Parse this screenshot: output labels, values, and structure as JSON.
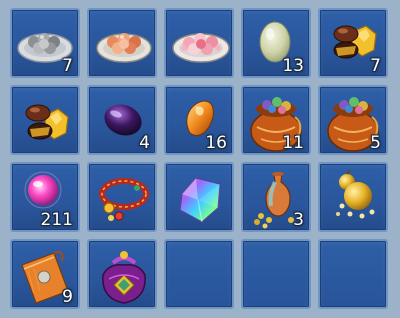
{
  "inventory": {
    "slots": [
      {
        "item": "grey-rice-balls-plate-icon",
        "qty": "7"
      },
      {
        "item": "orange-rice-balls-plate-icon",
        "qty": ""
      },
      {
        "item": "pink-rice-balls-plate-icon",
        "qty": ""
      },
      {
        "item": "jade-stone-icon",
        "qty": "13"
      },
      {
        "item": "gold-nuggets-icon",
        "qty": "7"
      },
      {
        "item": "gold-nuggets-icon",
        "qty": ""
      },
      {
        "item": "purple-gem-icon",
        "qty": "4"
      },
      {
        "item": "amber-stone-icon",
        "qty": "16"
      },
      {
        "item": "treasure-bag-icon",
        "qty": "11"
      },
      {
        "item": "treasure-bag-icon",
        "qty": "5"
      },
      {
        "item": "pink-pearl-icon",
        "qty": "211"
      },
      {
        "item": "red-bead-bracelet-icon",
        "qty": ""
      },
      {
        "item": "rainbow-crystal-icon",
        "qty": ""
      },
      {
        "item": "vase-with-coins-icon",
        "qty": "3"
      },
      {
        "item": "golden-gourd-icon",
        "qty": ""
      },
      {
        "item": "orange-silk-pouch-icon",
        "qty": "9"
      },
      {
        "item": "purple-charm-pouch-icon",
        "qty": ""
      },
      {
        "item": "",
        "qty": ""
      },
      {
        "item": "",
        "qty": ""
      },
      {
        "item": "",
        "qty": ""
      }
    ]
  }
}
